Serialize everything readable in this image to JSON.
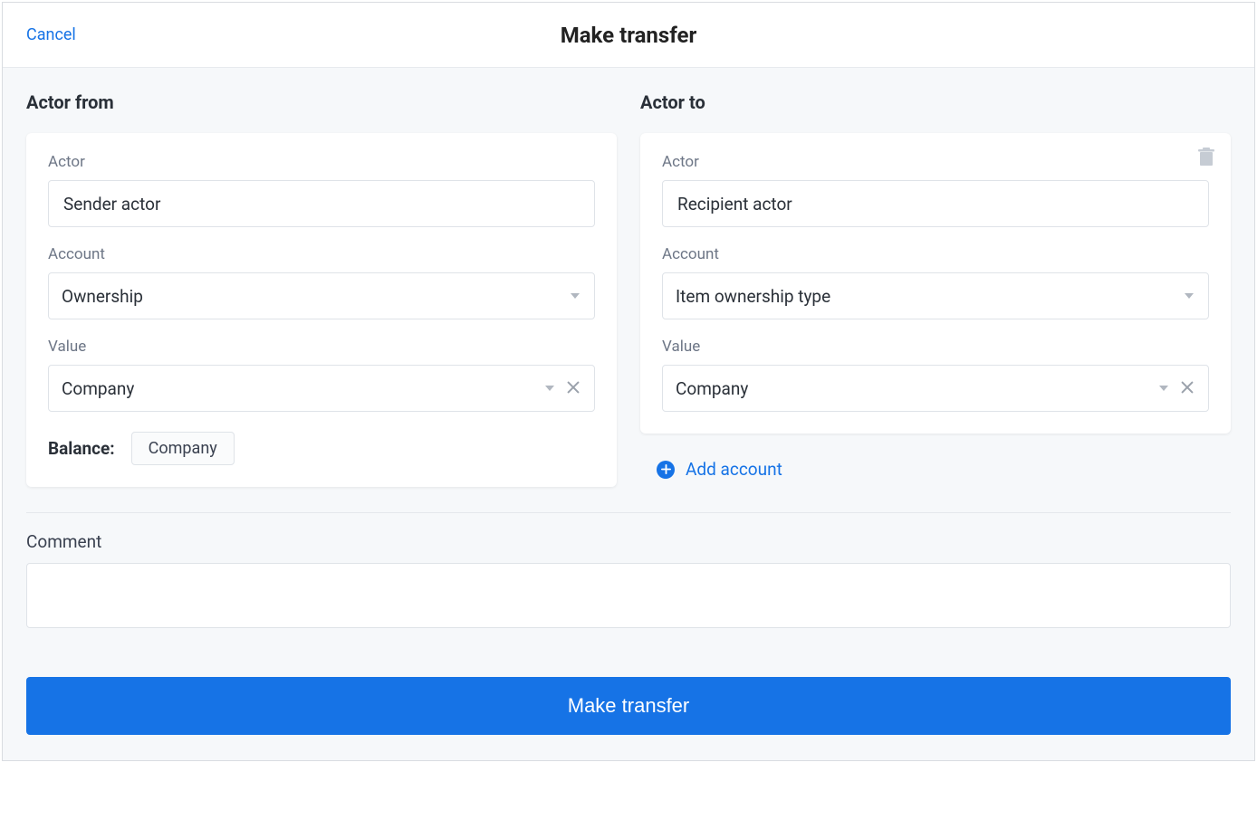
{
  "header": {
    "cancel": "Cancel",
    "title": "Make transfer"
  },
  "from": {
    "section": "Actor from",
    "actor_label": "Actor",
    "actor_value": "Sender actor",
    "account_label": "Account",
    "account_value": "Ownership",
    "value_label": "Value",
    "value_value": "Company",
    "balance_label": "Balance:",
    "balance_chip": "Company"
  },
  "to": {
    "section": "Actor to",
    "actor_label": "Actor",
    "actor_value": "Recipient actor",
    "account_label": "Account",
    "account_value": "Item ownership type",
    "value_label": "Value",
    "value_value": "Company",
    "add_account": "Add account"
  },
  "comment": {
    "label": "Comment",
    "value": ""
  },
  "submit": "Make transfer"
}
